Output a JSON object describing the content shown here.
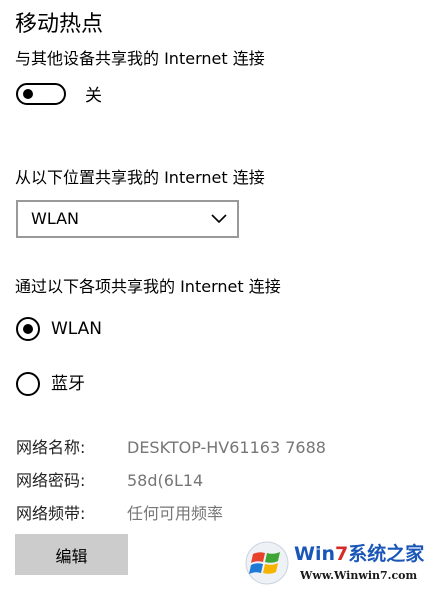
{
  "page": {
    "title": "移动热点"
  },
  "share_toggle": {
    "label": "与其他设备共享我的 Internet 连接",
    "state": "关",
    "on": false
  },
  "share_from": {
    "label": "从以下位置共享我的 Internet 连接",
    "selected": "WLAN",
    "chevron_icon": "chevron-down-icon"
  },
  "share_over": {
    "label": "通过以下各项共享我的 Internet 连接",
    "options": [
      {
        "label": "WLAN",
        "checked": true
      },
      {
        "label": "蓝牙",
        "checked": false
      }
    ]
  },
  "network_info": {
    "name_key": "网络名称:",
    "name_value": "DESKTOP-HV61163 7688",
    "password_key": "网络密码:",
    "password_value": "58d(6L14",
    "band_key": "网络频带:",
    "band_value": "任何可用频率"
  },
  "actions": {
    "edit_label": "编辑"
  },
  "watermark": {
    "brand_part1": "Win",
    "brand_part2": "7",
    "brand_part3": "系统之家",
    "url": "Www.Winwin7.com",
    "logo_icon": "windows-flag-icon"
  }
}
